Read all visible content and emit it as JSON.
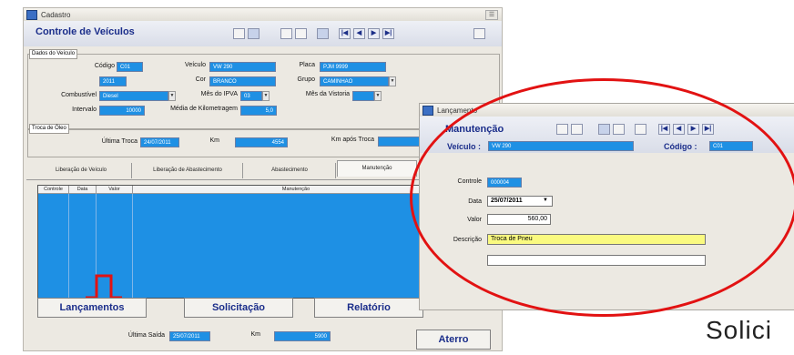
{
  "main_window": {
    "title": "Cadastro",
    "header_title": "Controle de Veículos",
    "vehicle_group": {
      "title": "Dados do Veículo",
      "codigo_label": "Código",
      "codigo_value": "C01",
      "veiculo_label": "Veículo",
      "veiculo_value": "VW 290",
      "placa_label": "Placa",
      "placa_value": "PJM 9999",
      "ano_label": "Ano",
      "ano_value": "2011",
      "cor_label": "Cor",
      "cor_value": "BRANCO",
      "grupo_label": "Grupo",
      "grupo_value": "CAMINHAO",
      "combustivel_label": "Combustível",
      "combustivel_value": "Diesel",
      "mes_ipva_label": "Mês do IPVA",
      "mes_ipva_value": "03",
      "mes_vistoria_label": "Mês da Vistoria",
      "mes_vistoria_value": "",
      "intervalo_label": "Intervalo",
      "intervalo_value": "10000",
      "media_label": "Média de Kilometragem",
      "media_value": "5,0"
    },
    "oil_group": {
      "title": "Troca de Óleo",
      "ultima_troca_label": "Última Troca",
      "ultima_troca_value": "24/07/2011",
      "km_label": "Km",
      "km_value": "4554",
      "km_apos_label": "Km após Troca",
      "km_apos_value": ""
    },
    "tabs": [
      "Liberação de Veículo",
      "Liberação de Abastecimento",
      "Abastecimento",
      "Manutenção"
    ],
    "grid_headers": [
      "Controle",
      "Data",
      "Valor",
      "Manutenção"
    ],
    "buttons": {
      "lancamentos": "Lançamentos",
      "solicitacao": "Solicitação",
      "relatorio": "Relatório",
      "aterro": "Aterro"
    },
    "footer": {
      "ultima_saida_label": "Última Saída",
      "ultima_saida_value": "25/07/2011",
      "km_label": "Km",
      "km_value": "5900"
    },
    "toolbar_nav": [
      "|◀",
      "◀",
      "▶",
      "▶|"
    ]
  },
  "launch_window": {
    "title": "Lançamento",
    "header_title": "Manutenção",
    "veiculo_label": "Veículo :",
    "veiculo_value": "VW 290",
    "codigo_label": "Código :",
    "codigo_value": "C01",
    "controle_label": "Controle",
    "controle_value": "000004",
    "data_label": "Data",
    "data_value": "25/07/2011",
    "valor_label": "Valor",
    "valor_value": "560,00",
    "descricao_label": "Descrição",
    "descricao_value": "Troca de Pneu",
    "toolbar_nav": [
      "|◀",
      "◀",
      "▶",
      "▶|"
    ]
  },
  "overlay_text": "Solici",
  "colors": {
    "field_blue": "#1e90e4",
    "title_navy": "#1a2d8a",
    "annotation_red": "#e21212",
    "highlight_yellow": "#fafa80"
  }
}
